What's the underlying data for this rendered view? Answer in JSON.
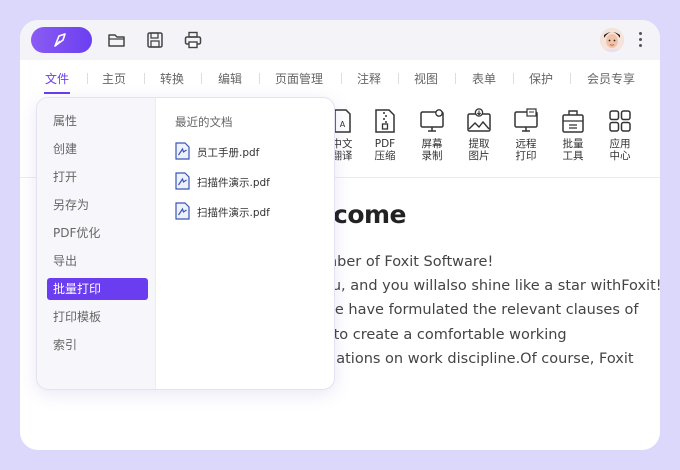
{
  "menu": {
    "tabs": [
      "文件",
      "主页",
      "转换",
      "编辑",
      "页面管理",
      "注释",
      "视图",
      "表单",
      "保护",
      "会员专享"
    ],
    "active_tab": "文件"
  },
  "toolbar": {
    "tools": [
      {
        "line1": "中文",
        "line2": "翻译",
        "icon": "translate-icon"
      },
      {
        "line1": "PDF",
        "line2": "压缩",
        "icon": "compress-icon"
      },
      {
        "line1": "屏幕",
        "line2": "录制",
        "icon": "screen-record-icon"
      },
      {
        "line1": "提取",
        "line2": "图片",
        "icon": "extract-image-icon"
      },
      {
        "line1": "远程",
        "line2": "打印",
        "icon": "remote-print-icon"
      },
      {
        "line1": "批量",
        "line2": "工具",
        "icon": "batch-tools-icon"
      },
      {
        "line1": "应用",
        "line2": "中心",
        "icon": "app-center-icon"
      }
    ]
  },
  "file_menu": {
    "items": [
      "属性",
      "创建",
      "打开",
      "另存为",
      "PDF优化",
      "导出",
      "批量打印",
      "打印模板",
      "索引"
    ],
    "selected": "批量打印",
    "recent_title": "最近的文档",
    "recent_files": [
      "员工手册.pdf",
      "扫描件演示.pdf",
      "扫描件演示.pdf"
    ]
  },
  "document": {
    "title_visible": "come",
    "lines": [
      "mber of Foxit Software!",
      "ou, and you willalso shine like a star withFoxit!",
      "we have formulated the relevant clauses of",
      "r to create a comfortable working",
      "ulations on work discipline.Of course, Foxit"
    ]
  },
  "colors": {
    "accent": "#6a3df0",
    "background": "#dcd8fb"
  }
}
